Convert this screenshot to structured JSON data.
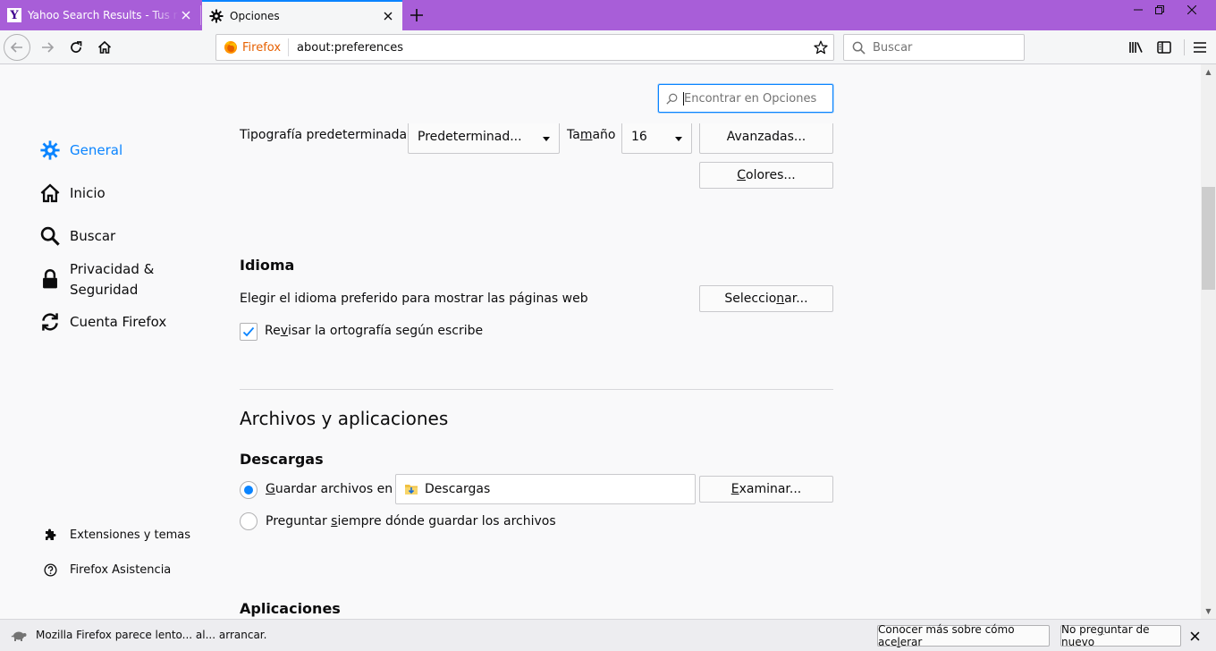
{
  "tabs": [
    {
      "title": "Yahoo Search Results - Tus resultados",
      "favicon": "yahoo-icon"
    },
    {
      "title": "Opciones",
      "favicon": "gear-icon",
      "active": true
    }
  ],
  "toolbar": {
    "identity_label": "Firefox",
    "url": "about:preferences",
    "search_placeholder": "Buscar"
  },
  "find": {
    "placeholder": "Encontrar en Opciones"
  },
  "sidebar": {
    "items": [
      {
        "label": "General",
        "icon": "gear-icon",
        "selected": true
      },
      {
        "label": "Inicio",
        "icon": "home-icon"
      },
      {
        "label": "Buscar",
        "icon": "search-icon"
      },
      {
        "label": "Privacidad & Seguridad",
        "icon": "lock-icon"
      },
      {
        "label": "Cuenta Firefox",
        "icon": "sync-icon"
      }
    ],
    "footer": [
      {
        "label": "Extensiones y temas",
        "icon": "puzzle-icon"
      },
      {
        "label": "Firefox Asistencia",
        "icon": "help-icon"
      }
    ]
  },
  "fonts": {
    "label": "Tipografía predeterminada",
    "font_value": "Predeterminad...",
    "size_label_a": "Ta",
    "size_label_m": "m",
    "size_label_b": "año",
    "size_value": "16",
    "advanced_label": "Avanzadas...",
    "colors_label_a": "C",
    "colors_label_b": "olores..."
  },
  "language": {
    "heading": "Idioma",
    "description": "Elegir el idioma preferido para mostrar las páginas web",
    "select_label_a": "Seleccio",
    "select_label_n": "n",
    "select_label_b": "ar...",
    "spellcheck_a": "Re",
    "spellcheck_v": "v",
    "spellcheck_b": "isar la ortografía según escribe",
    "spellcheck_checked": true
  },
  "files": {
    "section_title": "Archivos y aplicaciones",
    "downloads_heading": "Descargas",
    "save_to_g": "G",
    "save_to_rest": "uardar archivos en",
    "folder_name": "Descargas",
    "browse_a": "E",
    "browse_x": "x",
    "browse_b": "aminar...",
    "always_ask_a": "Preguntar ",
    "always_ask_s": "s",
    "always_ask_b": "iempre dónde guardar los archivos",
    "selected_option": "save_to",
    "applications_heading": "Aplicaciones"
  },
  "notification": {
    "message": "Mozilla Firefox parece lento... al... arrancar.",
    "learn_more_a": "Conocer más sobre cómo ace",
    "learn_more_l": "l",
    "learn_more_b": "erar",
    "dont_ask_a": "No pre",
    "dont_ask_g": "g",
    "dont_ask_b": "untar de nuevo"
  },
  "colors": {
    "accent": "#0a84ff",
    "tabbar": "#a85ed8",
    "identity": "#e66000"
  }
}
